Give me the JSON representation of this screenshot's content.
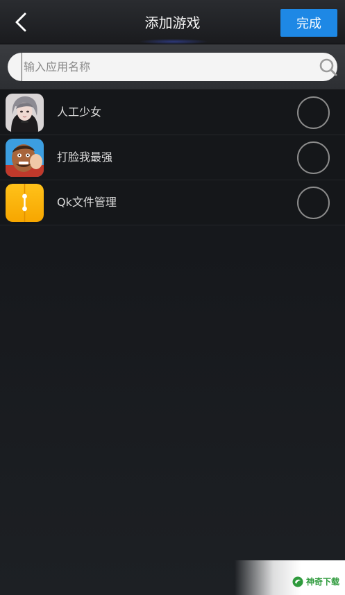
{
  "header": {
    "title": "添加游戏",
    "done_label": "完成"
  },
  "search": {
    "placeholder": "输入应用名称"
  },
  "apps": [
    {
      "name": "人工少女",
      "icon": "anime-girl-portrait-icon",
      "selected": false
    },
    {
      "name": "打脸我最强",
      "icon": "slapped-man-face-icon",
      "selected": false
    },
    {
      "name": "Qk文件管理",
      "icon": "yellow-folder-zip-icon",
      "selected": false
    }
  ],
  "watermark": {
    "text": "神奇下载",
    "icon": "leaf-logo-icon"
  },
  "colors": {
    "accent": "#1e88e5",
    "background": "#16181c",
    "watermark_green": "#2e9a3c"
  }
}
